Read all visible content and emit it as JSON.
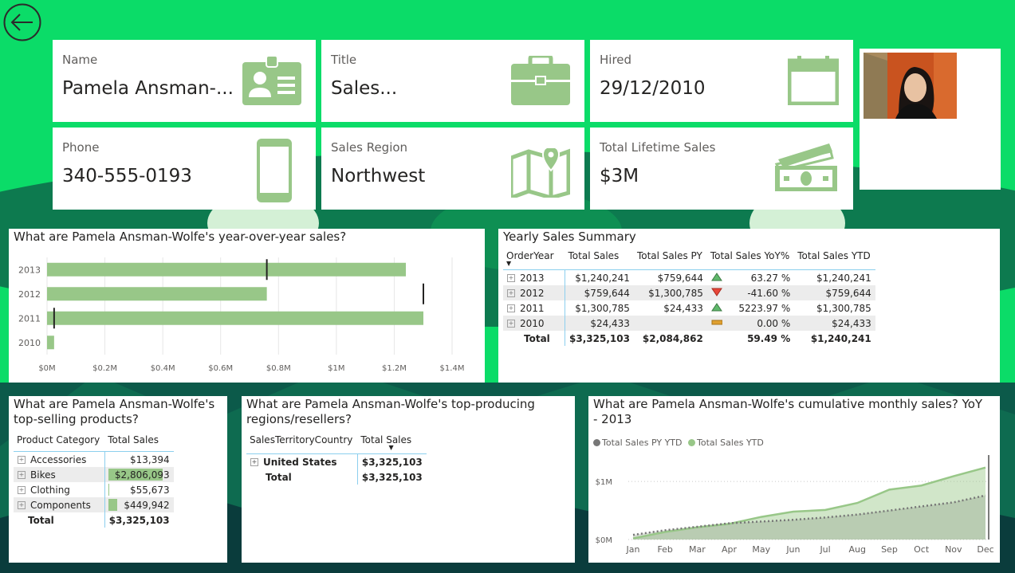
{
  "header": {
    "back_icon": "back-arrow-icon"
  },
  "cards": {
    "name": {
      "label": "Name",
      "value": "Pamela Ansman-...",
      "icon": "id-card-icon"
    },
    "title": {
      "label": "Title",
      "value": "Sales...",
      "icon": "briefcase-icon"
    },
    "hired": {
      "label": "Hired",
      "value": "29/12/2010",
      "icon": "calendar-icon"
    },
    "phone": {
      "label": "Phone",
      "value": "340-555-0193",
      "icon": "phone-icon"
    },
    "region": {
      "label": "Sales Region",
      "value": "Northwest",
      "icon": "map-icon"
    },
    "lifetime": {
      "label": "Total Lifetime Sales",
      "value": "$3M",
      "icon": "money-icon"
    }
  },
  "photo": {
    "icon": "employee-photo"
  },
  "colors": {
    "accent": "#98c788",
    "background": "#0bdc68",
    "py_line": "#777777",
    "ytd_line": "#98c788",
    "header_rule": "#8ccfee"
  },
  "yoy_visual": {
    "title": "What are Pamela Ansman-Wolfe's year-over-year sales?",
    "chart_data": {
      "type": "bar",
      "orientation": "horizontal",
      "categories": [
        "2013",
        "2012",
        "2011",
        "2010"
      ],
      "values": [
        1240241,
        759644,
        1300785,
        24433
      ],
      "target_markers": [
        759644,
        1300785,
        24433,
        null
      ],
      "xlim": [
        0,
        1400000
      ],
      "xticks": [
        0,
        200000,
        400000,
        600000,
        800000,
        1000000,
        1200000,
        1400000
      ],
      "xtick_labels": [
        "$0M",
        "$0.2M",
        "$0.4M",
        "$0.6M",
        "$0.8M",
        "$1M",
        "$1.2M",
        "$1.4M"
      ],
      "grid": true
    }
  },
  "summary": {
    "title": "Yearly Sales Summary",
    "columns": [
      "OrderYear",
      "Total Sales",
      "Total Sales PY",
      "Total Sales YoY%",
      "Total Sales YTD"
    ],
    "rows": [
      {
        "year": "2013",
        "sales": "$1,240,241",
        "py": "$759,644",
        "trend": "up",
        "yoy": "63.27 %",
        "ytd": "$1,240,241"
      },
      {
        "year": "2012",
        "sales": "$759,644",
        "py": "$1,300,785",
        "trend": "down",
        "yoy": "-41.60 %",
        "ytd": "$759,644"
      },
      {
        "year": "2011",
        "sales": "$1,300,785",
        "py": "$24,433",
        "trend": "up",
        "yoy": "5223.97 %",
        "ytd": "$1,300,785"
      },
      {
        "year": "2010",
        "sales": "$24,433",
        "py": "",
        "trend": "flat",
        "yoy": "0.00 %",
        "ytd": "$24,433"
      }
    ],
    "total": {
      "label": "Total",
      "sales": "$3,325,103",
      "py": "$2,084,862",
      "yoy": "59.49 %",
      "ytd": "$1,240,241"
    }
  },
  "products": {
    "title_line1": "What are Pamela Ansman-Wolfe's",
    "title_line2": "top-selling products?",
    "columns": [
      "Product Category",
      "Total Sales"
    ],
    "rows": [
      {
        "name": "Accessories",
        "value": "$13,394",
        "fraction": 0.005
      },
      {
        "name": "Bikes",
        "value": "$2,806,093",
        "fraction": 1.0
      },
      {
        "name": "Clothing",
        "value": "$55,673",
        "fraction": 0.02
      },
      {
        "name": "Components",
        "value": "$449,942",
        "fraction": 0.16
      }
    ],
    "total": {
      "label": "Total",
      "value": "$3,325,103"
    }
  },
  "regions": {
    "title_line1": "What are Pamela Ansman-Wolfe's top-producing",
    "title_line2": "regions/resellers?",
    "columns": [
      "SalesTerritoryCountry",
      "Total Sales"
    ],
    "rows": [
      {
        "name": "United States",
        "value": "$3,325,103"
      }
    ],
    "total": {
      "label": "Total",
      "value": "$3,325,103"
    }
  },
  "cumulative": {
    "title_line1": "What are Pamela Ansman-Wolfe's cumulative monthly sales? YoY",
    "title_line2": "- 2013",
    "legend": [
      {
        "name": "Total Sales PY YTD",
        "color": "#777777"
      },
      {
        "name": "Total Sales YTD",
        "color": "#98c788"
      }
    ],
    "chart_data": {
      "type": "area",
      "categories": [
        "Jan",
        "Feb",
        "Mar",
        "Apr",
        "May",
        "Jun",
        "Jul",
        "Aug",
        "Sep",
        "Oct",
        "Nov",
        "Dec"
      ],
      "series": [
        {
          "name": "Total Sales PY YTD",
          "values": [
            0.08,
            0.16,
            0.22,
            0.28,
            0.31,
            0.34,
            0.38,
            0.43,
            0.5,
            0.57,
            0.64,
            0.76
          ],
          "style": "dotted"
        },
        {
          "name": "Total Sales YTD",
          "values": [
            0.02,
            0.13,
            0.21,
            0.27,
            0.39,
            0.48,
            0.51,
            0.63,
            0.86,
            0.93,
            1.09,
            1.24
          ],
          "style": "solid"
        }
      ],
      "ylim": [
        0,
        1.4
      ],
      "yticks": [
        0,
        1
      ],
      "ytick_labels": [
        "$0M",
        "$1M"
      ],
      "units": "$M"
    }
  }
}
